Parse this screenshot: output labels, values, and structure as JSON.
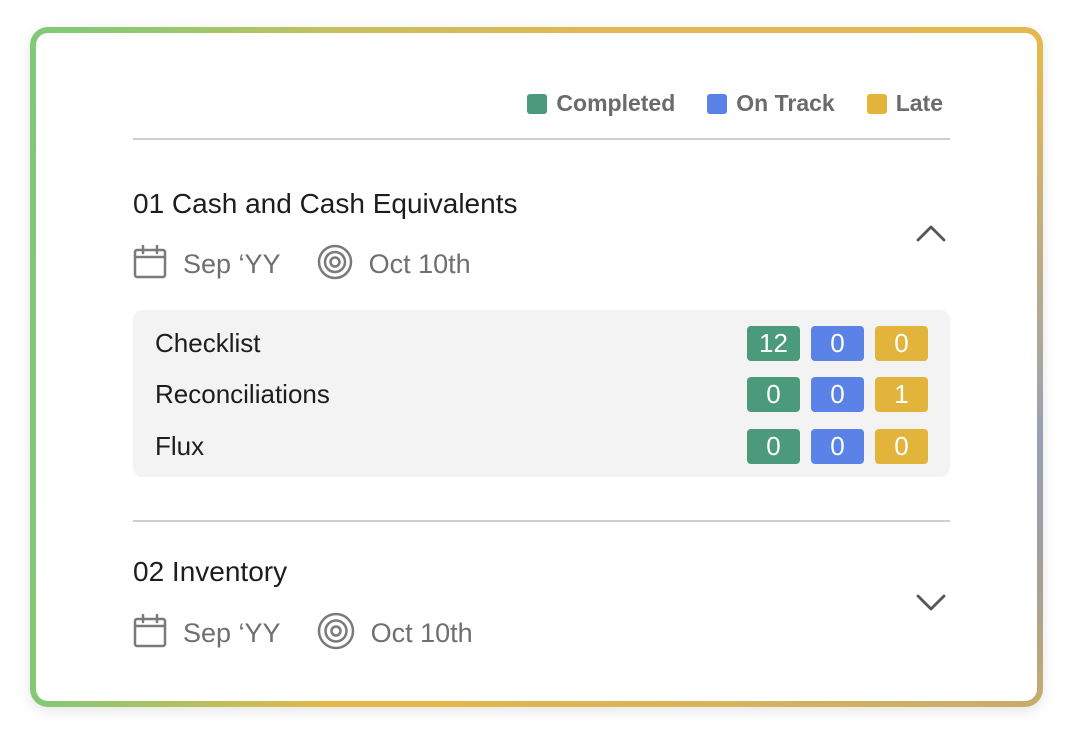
{
  "colors": {
    "completed": "#4a9a7b",
    "on_track": "#5b82e6",
    "late": "#e2b43c"
  },
  "legend": [
    {
      "label": "Completed",
      "color": "#4a9a7b"
    },
    {
      "label": "On Track",
      "color": "#5b82e6"
    },
    {
      "label": "Late",
      "color": "#e2b43c"
    }
  ],
  "sections": [
    {
      "title": "01 Cash and Cash Equivalents",
      "period": "Sep ‘YY",
      "due": "Oct 10th",
      "expanded": true,
      "chevron_icon": "chevron-up-icon",
      "rows": [
        {
          "label": "Checklist",
          "completed": "12",
          "on_track": "0",
          "late": "0"
        },
        {
          "label": "Reconciliations",
          "completed": "0",
          "on_track": "0",
          "late": "1"
        },
        {
          "label": "Flux",
          "completed": "0",
          "on_track": "0",
          "late": "0"
        }
      ]
    },
    {
      "title": "02 Inventory",
      "period": "Sep ‘YY",
      "due": "Oct 10th",
      "expanded": false,
      "chevron_icon": "chevron-down-icon"
    }
  ],
  "icons": {
    "period": "calendar-icon",
    "due": "target-icon"
  }
}
